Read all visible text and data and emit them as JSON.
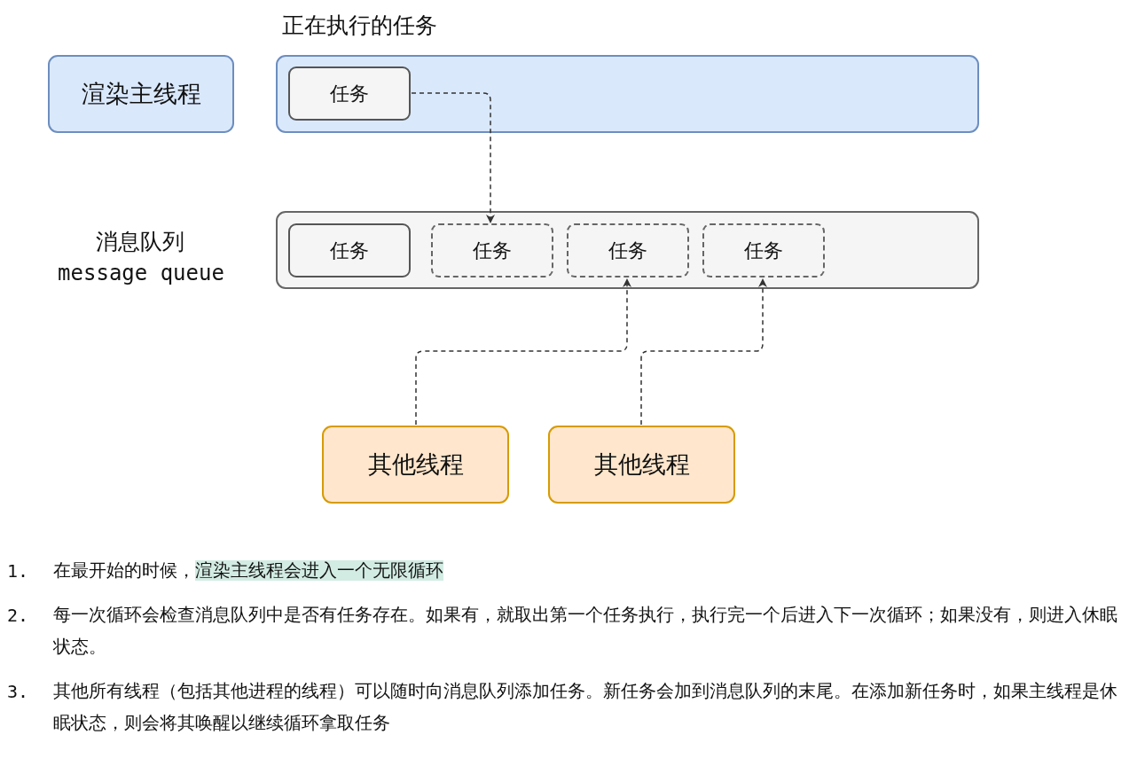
{
  "running_title": "正在执行的任务",
  "main_thread": {
    "label": "渲染主线程"
  },
  "running_tasks": [
    {
      "label": "任务"
    }
  ],
  "queue": {
    "label": "消息队列",
    "label_en": "message queue"
  },
  "queue_tasks": [
    {
      "label": "任务",
      "kind": "solid"
    },
    {
      "label": "任务",
      "kind": "dashed"
    },
    {
      "label": "任务",
      "kind": "dashed"
    },
    {
      "label": "任务",
      "kind": "dashed"
    }
  ],
  "other_threads": [
    {
      "label": "其他线程"
    },
    {
      "label": "其他线程"
    }
  ],
  "notes": [
    {
      "number": "1.",
      "parts": [
        {
          "text": "在最开始的时候，",
          "highlighted": false
        },
        {
          "text": "渲染主线程会进入一个无限循环",
          "highlighted": true
        }
      ]
    },
    {
      "number": "2.",
      "parts": [
        {
          "text": "每一次循环会检查消息队列中是否有任务存在。如果有，就取出第一个任务执行，执行完一个后进入下一次循环；如果没有，则进入休眠状态。",
          "highlighted": false
        }
      ]
    },
    {
      "number": "3.",
      "parts": [
        {
          "text": "其他所有线程（包括其他进程的线程）可以随时向消息队列添加任务。新任务会加到消息队列的末尾。在添加新任务时，如果主线程是休眠状态，则会将其唤醒以继续循环拿取任务",
          "highlighted": false
        }
      ]
    }
  ]
}
